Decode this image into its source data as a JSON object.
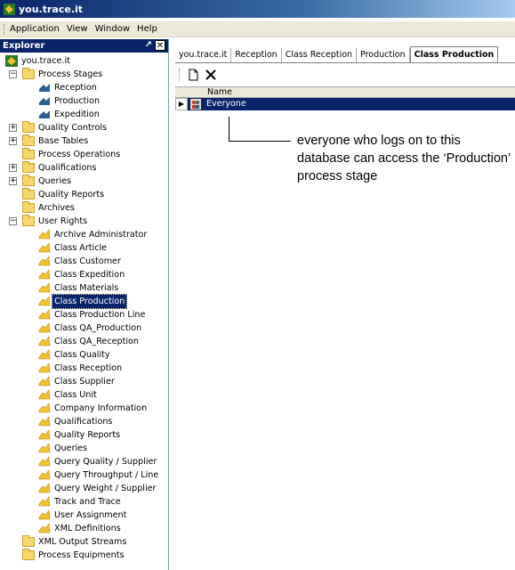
{
  "app": {
    "title": "you.trace.it"
  },
  "menu": [
    "Application",
    "View",
    "Window",
    "Help"
  ],
  "explorer": {
    "title": "Explorer",
    "tree": [
      {
        "label": "you.trace.it",
        "level": 0,
        "icon": "app-logo-icon",
        "expander": ""
      },
      {
        "label": "Process Stages",
        "level": 1,
        "icon": "folder-icon",
        "expander": "minus"
      },
      {
        "label": "Reception",
        "level": 2,
        "icon": "process-stage-icon",
        "expander": ""
      },
      {
        "label": "Production",
        "level": 2,
        "icon": "process-stage-icon",
        "expander": ""
      },
      {
        "label": "Expedition",
        "level": 2,
        "icon": "process-stage-icon",
        "expander": ""
      },
      {
        "label": "Quality Controls",
        "level": 1,
        "icon": "folder-icon",
        "expander": "plus"
      },
      {
        "label": "Base Tables",
        "level": 1,
        "icon": "folder-icon",
        "expander": "plus"
      },
      {
        "label": "Process Operations",
        "level": 1,
        "icon": "folder-icon",
        "expander": ""
      },
      {
        "label": "Qualifications",
        "level": 1,
        "icon": "folder-icon",
        "expander": "plus"
      },
      {
        "label": "Queries",
        "level": 1,
        "icon": "folder-icon",
        "expander": "plus"
      },
      {
        "label": "Quality Reports",
        "level": 1,
        "icon": "folder-icon",
        "expander": ""
      },
      {
        "label": "Archives",
        "level": 1,
        "icon": "folder-icon",
        "expander": ""
      },
      {
        "label": "User Rights",
        "level": 1,
        "icon": "folder-icon",
        "expander": "minus"
      },
      {
        "label": "Archive Administrator",
        "level": 2,
        "icon": "user-right-icon",
        "expander": ""
      },
      {
        "label": "Class Article",
        "level": 2,
        "icon": "user-right-icon",
        "expander": ""
      },
      {
        "label": "Class Customer",
        "level": 2,
        "icon": "user-right-icon",
        "expander": ""
      },
      {
        "label": "Class Expedition",
        "level": 2,
        "icon": "user-right-icon",
        "expander": ""
      },
      {
        "label": "Class Materials",
        "level": 2,
        "icon": "user-right-icon",
        "expander": ""
      },
      {
        "label": "Class Production",
        "level": 2,
        "icon": "user-right-icon",
        "expander": "",
        "selected": true
      },
      {
        "label": "Class Production Line",
        "level": 2,
        "icon": "user-right-icon",
        "expander": ""
      },
      {
        "label": "Class QA_Production",
        "level": 2,
        "icon": "user-right-icon",
        "expander": ""
      },
      {
        "label": "Class QA_Reception",
        "level": 2,
        "icon": "user-right-icon",
        "expander": ""
      },
      {
        "label": "Class Quality",
        "level": 2,
        "icon": "user-right-icon",
        "expander": ""
      },
      {
        "label": "Class Reception",
        "level": 2,
        "icon": "user-right-icon",
        "expander": ""
      },
      {
        "label": "Class Supplier",
        "level": 2,
        "icon": "user-right-icon",
        "expander": ""
      },
      {
        "label": "Class Unit",
        "level": 2,
        "icon": "user-right-icon",
        "expander": ""
      },
      {
        "label": "Company Information",
        "level": 2,
        "icon": "user-right-icon",
        "expander": ""
      },
      {
        "label": "Qualifications",
        "level": 2,
        "icon": "user-right-icon",
        "expander": ""
      },
      {
        "label": "Quality Reports",
        "level": 2,
        "icon": "user-right-icon",
        "expander": ""
      },
      {
        "label": "Queries",
        "level": 2,
        "icon": "user-right-icon",
        "expander": ""
      },
      {
        "label": "Query Quality / Supplier",
        "level": 2,
        "icon": "user-right-icon",
        "expander": ""
      },
      {
        "label": "Query Throughput / Line",
        "level": 2,
        "icon": "user-right-icon",
        "expander": ""
      },
      {
        "label": "Query Weight / Supplier",
        "level": 2,
        "icon": "user-right-icon",
        "expander": ""
      },
      {
        "label": "Track and Trace",
        "level": 2,
        "icon": "user-right-icon",
        "expander": ""
      },
      {
        "label": "User Assignment",
        "level": 2,
        "icon": "user-right-icon",
        "expander": ""
      },
      {
        "label": "XML Definitions",
        "level": 2,
        "icon": "user-right-icon",
        "expander": ""
      },
      {
        "label": "XML Output Streams",
        "level": 1,
        "icon": "folder-icon",
        "expander": ""
      },
      {
        "label": "Process Equipments",
        "level": 1,
        "icon": "folder-icon",
        "expander": ""
      }
    ]
  },
  "tabs": [
    {
      "label": "you.trace.it",
      "active": false
    },
    {
      "label": "Reception",
      "active": false
    },
    {
      "label": "Class Reception",
      "active": false
    },
    {
      "label": "Production",
      "active": false
    },
    {
      "label": "Class Production",
      "active": true
    }
  ],
  "grid": {
    "column": "Name",
    "rows": [
      {
        "name": "Everyone"
      }
    ]
  },
  "annotation": "everyone who logs on to this database can access the ‘Production’ process stage",
  "colors": {
    "selection": "#0a246a",
    "folder": "#f5d76e",
    "stage": "#2b5f93",
    "right": "#f2c230"
  }
}
